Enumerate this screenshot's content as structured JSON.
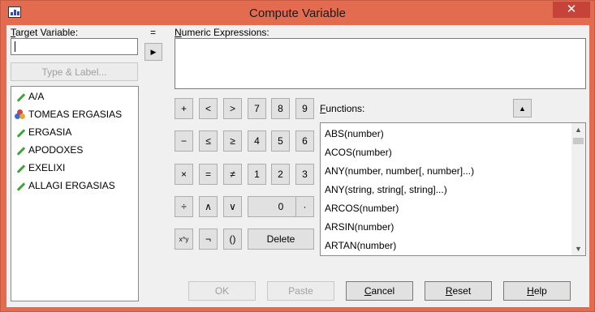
{
  "window": {
    "title": "Compute Variable",
    "close_glyph": "✕"
  },
  "target": {
    "label_u": "T",
    "label_rest": "arget Variable:",
    "value": ""
  },
  "equals": "=",
  "numexp": {
    "label_u": "N",
    "label_rest": "umeric Expressions:",
    "value": ""
  },
  "type_label_button": "Type & Label...",
  "variables": [
    {
      "name": "A/A",
      "icon": "scale-pencil-icon"
    },
    {
      "name": "TOMEAS ERGASIAS",
      "icon": "nominal-circles-icon"
    },
    {
      "name": "ERGASIA",
      "icon": "scale-pencil-icon"
    },
    {
      "name": "APODOXES",
      "icon": "scale-pencil-icon"
    },
    {
      "name": "EXELIXI",
      "icon": "scale-pencil-icon"
    },
    {
      "name": "ALLAGI ERGASIAS",
      "icon": "scale-pencil-icon"
    }
  ],
  "calc": {
    "plus": "+",
    "lt": "<",
    "gt": ">",
    "d7": "7",
    "d8": "8",
    "d9": "9",
    "minus": "−",
    "le": "≤",
    "ge": "≥",
    "d4": "4",
    "d5": "5",
    "d6": "6",
    "times": "×",
    "eq": "=",
    "ne": "≠",
    "d1": "1",
    "d2": "2",
    "d3": "3",
    "div": "÷",
    "and": "∧",
    "or": "∨",
    "d0": "0",
    "dot": "·",
    "pow": "x^y",
    "not": "¬",
    "paren": "()",
    "delete": "Delete"
  },
  "functions": {
    "label_u": "F",
    "label_rest": "unctions:",
    "items": [
      "ABS(number)",
      "ACOS(number)",
      "ANY(number, number[, number]...)",
      "ANY(string, string[, string]...)",
      "ARCOS(number)",
      "ARSIN(number)",
      "ARTAN(number)"
    ]
  },
  "footer": {
    "ok": "OK",
    "paste": "Paste",
    "cancel": "Cancel",
    "reset": "Reset",
    "help": "Help"
  },
  "colors": {
    "titlebar": "#e36b50",
    "close": "#c6433a",
    "pencil": "#3ea33e",
    "dialog_bg": "#f0f0f0"
  }
}
